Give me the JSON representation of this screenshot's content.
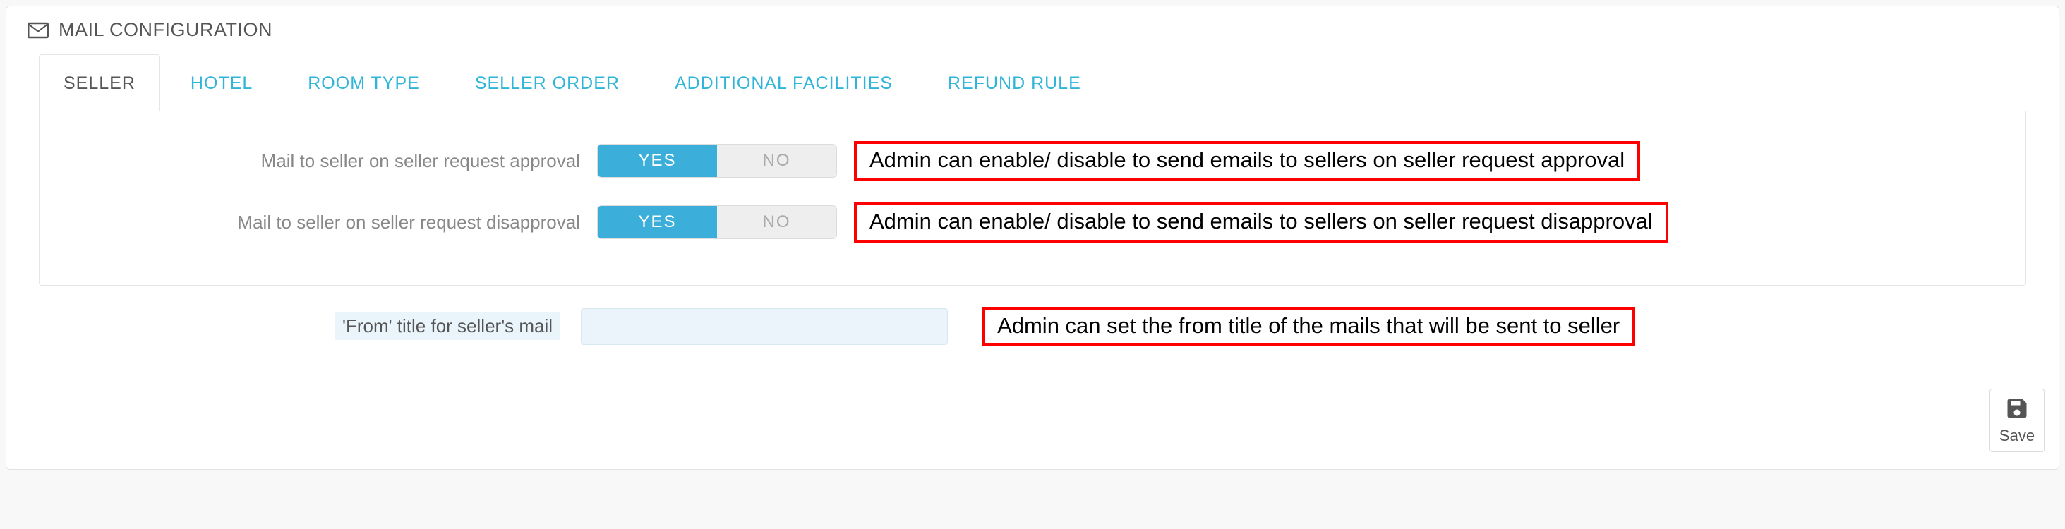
{
  "panel": {
    "title": "MAIL CONFIGURATION"
  },
  "tabs": [
    {
      "label": "SELLER",
      "active": true
    },
    {
      "label": "HOTEL",
      "active": false
    },
    {
      "label": "ROOM TYPE",
      "active": false
    },
    {
      "label": "SELLER ORDER",
      "active": false
    },
    {
      "label": "ADDITIONAL FACILITIES",
      "active": false
    },
    {
      "label": "REFUND RULE",
      "active": false
    }
  ],
  "settings": {
    "approval": {
      "label": "Mail to seller on seller request approval",
      "yes": "YES",
      "no": "NO",
      "value": "YES",
      "annotation": "Admin can enable/ disable to send emails to sellers  on seller request approval"
    },
    "disapproval": {
      "label": "Mail to seller on seller request disapproval",
      "yes": "YES",
      "no": "NO",
      "value": "YES",
      "annotation": "Admin can enable/ disable to send emails to sellers  on seller request disapproval"
    }
  },
  "from_title": {
    "label": "'From' title for seller's mail",
    "value": "",
    "annotation": "Admin can set the from title of the mails that will be sent to seller"
  },
  "actions": {
    "save": "Save"
  }
}
